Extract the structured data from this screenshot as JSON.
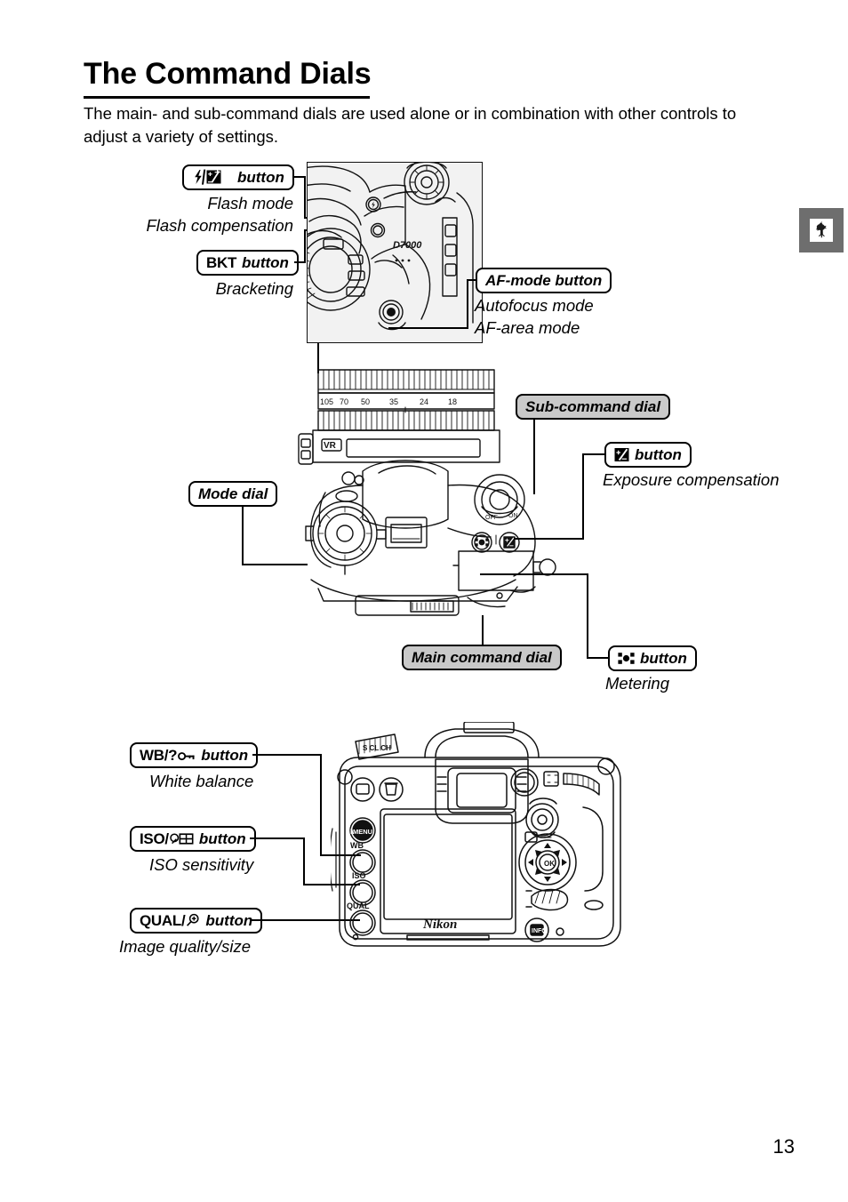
{
  "page": {
    "title": "The Command Dials",
    "intro": "The main- and sub-command dials are used alone or in combination with other controls to adjust a variety of settings.",
    "number": "13",
    "side_tab_icon": "weathervane-rooster-icon",
    "camera_model": "D7000",
    "brand": "Nikon"
  },
  "colors": {
    "gray_fill": "#c9c9c9",
    "tab_gray": "#6e6e6e",
    "panel_bg": "#f2f2f2",
    "ink": "#000000"
  },
  "callouts": {
    "flash": {
      "label": "button",
      "icon": "flash-compensation-icon",
      "functions": [
        "Flash mode",
        "Flash compensation"
      ]
    },
    "bkt": {
      "prefix": "BKT",
      "label": "button",
      "functions": [
        "Bracketing"
      ]
    },
    "af_mode": {
      "label": "AF-mode button",
      "functions": [
        "Autofocus mode",
        "AF-area mode"
      ]
    },
    "sub_command_dial": {
      "label": "Sub-command dial",
      "filled": true
    },
    "exposure_compensation": {
      "label": "button",
      "icon": "exposure-compensation-icon",
      "functions": [
        "Exposure compensation"
      ]
    },
    "mode_dial": {
      "label": "Mode dial",
      "filled": false
    },
    "main_command_dial": {
      "label": "Main command dial",
      "filled": true
    },
    "metering": {
      "label": "button",
      "icon": "matrix-metering-icon",
      "functions": [
        "Metering"
      ]
    },
    "white_balance": {
      "prefix": "WB/?",
      "label": "button",
      "icon": "key-protect-icon",
      "functions": [
        "White balance"
      ]
    },
    "iso": {
      "prefix": "ISO/",
      "label": "button",
      "icon": "zoom-out-thumbnail-icon",
      "functions": [
        "ISO sensitivity"
      ]
    },
    "quality": {
      "prefix": "QUAL/",
      "label": "button",
      "icon": "zoom-in-icon",
      "functions": [
        "Image quality/size"
      ]
    }
  },
  "lens": {
    "focal_ticks": [
      "105",
      "70",
      "50",
      "35",
      "24",
      "18"
    ],
    "vr_label": "VR"
  },
  "rear_buttons": {
    "wb": "WB",
    "iso": "ISO",
    "qual": "QUAL",
    "menu": "MENU",
    "ok": "OK",
    "info": "INFO"
  },
  "top_controls": {
    "power_off": "OFF",
    "power_on": "ON"
  }
}
